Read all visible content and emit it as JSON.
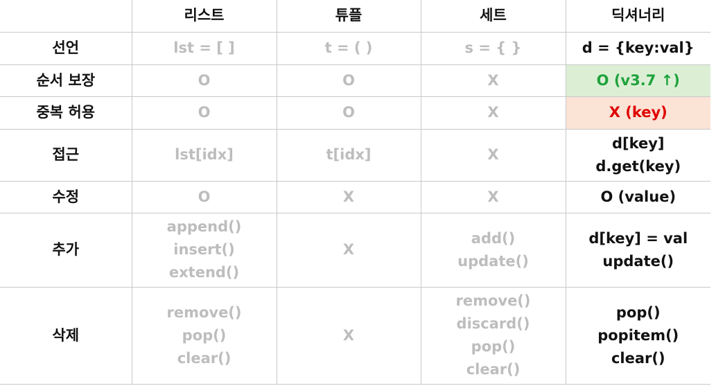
{
  "header": {
    "corner": "",
    "columns": [
      "리스트",
      "튜플",
      "세트",
      "딕셔너리"
    ]
  },
  "rows": [
    {
      "label": "선언",
      "list": [
        "lst = [ ]"
      ],
      "tuple": [
        "t = ( )"
      ],
      "set": [
        "s = { }"
      ],
      "dict": [
        "d = {key:val}"
      ]
    },
    {
      "label": "순서 보장",
      "list": [
        "O"
      ],
      "tuple": [
        "O"
      ],
      "set": [
        "X"
      ],
      "dict": [
        "O (v3.7 ↑)"
      ]
    },
    {
      "label": "중복 허용",
      "list": [
        "O"
      ],
      "tuple": [
        "O"
      ],
      "set": [
        "X"
      ],
      "dict": [
        "X (key)"
      ]
    },
    {
      "label": "접근",
      "list": [
        "lst[idx]"
      ],
      "tuple": [
        "t[idx]"
      ],
      "set": [
        "X"
      ],
      "dict": [
        "d[key]",
        "d.get(key)"
      ]
    },
    {
      "label": "수정",
      "list": [
        "O"
      ],
      "tuple": [
        "X"
      ],
      "set": [
        "X"
      ],
      "dict": [
        "O (value)"
      ]
    },
    {
      "label": "추가",
      "list": [
        "append()",
        "insert()",
        "extend()"
      ],
      "tuple": [
        "X"
      ],
      "set": [
        "add()",
        "update()"
      ],
      "dict": [
        "d[key] = val",
        "update()"
      ]
    },
    {
      "label": "삭제",
      "list": [
        "remove()",
        "pop()",
        "clear()"
      ],
      "tuple": [
        "X"
      ],
      "set": [
        "remove()",
        "discard()",
        "pop()",
        "clear()"
      ],
      "dict": [
        "pop()",
        "popitem()",
        "clear()"
      ]
    }
  ],
  "colors": {
    "muted": "#bdbdbd",
    "green_text": "#1fa23c",
    "green_bg": "#dcefd5",
    "red_text": "#e00000",
    "red_bg": "#fbe3d6"
  }
}
